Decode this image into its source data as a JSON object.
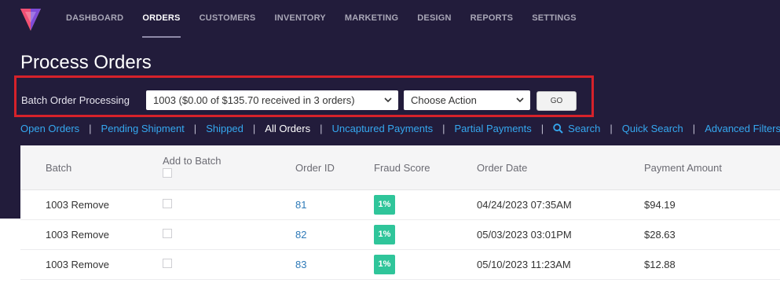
{
  "nav": {
    "items": [
      {
        "label": "DASHBOARD",
        "active": false
      },
      {
        "label": "ORDERS",
        "active": true
      },
      {
        "label": "CUSTOMERS",
        "active": false
      },
      {
        "label": "INVENTORY",
        "active": false
      },
      {
        "label": "MARKETING",
        "active": false
      },
      {
        "label": "DESIGN",
        "active": false
      },
      {
        "label": "REPORTS",
        "active": false
      },
      {
        "label": "SETTINGS",
        "active": false
      }
    ]
  },
  "page": {
    "title": "Process Orders"
  },
  "batch": {
    "label": "Batch Order Processing",
    "selected_batch": "1003 ($0.00 of $135.70 received in 3 orders)",
    "action_selected": "Choose Action",
    "go_label": "GO"
  },
  "filters": [
    {
      "label": "Open Orders",
      "active": false
    },
    {
      "label": "Pending Shipment",
      "active": false
    },
    {
      "label": "Shipped",
      "active": false
    },
    {
      "label": "All Orders",
      "active": true
    },
    {
      "label": "Uncaptured Payments",
      "active": false
    },
    {
      "label": "Partial Payments",
      "active": false
    },
    {
      "label": "Search",
      "active": false,
      "icon": "search-icon"
    },
    {
      "label": "Quick Search",
      "active": false
    },
    {
      "label": "Advanced Filters",
      "active": false
    }
  ],
  "table": {
    "headers": {
      "batch": "Batch",
      "add_to_batch": "Add to Batch",
      "order_id": "Order ID",
      "fraud_score": "Fraud Score",
      "order_date": "Order Date",
      "payment_amount": "Payment Amount"
    },
    "rows": [
      {
        "batch": "1003 Remove",
        "order_id": "81",
        "fraud": "1%",
        "date": "04/24/2023 07:35AM",
        "amount": "$94.19"
      },
      {
        "batch": "1003 Remove",
        "order_id": "82",
        "fraud": "1%",
        "date": "05/03/2023 03:01PM",
        "amount": "$28.63"
      },
      {
        "batch": "1003 Remove",
        "order_id": "83",
        "fraud": "1%",
        "date": "05/10/2023 11:23AM",
        "amount": "$12.88"
      }
    ]
  },
  "colors": {
    "header_bg": "#221c3b",
    "highlight_border": "#d6222a",
    "link": "#35a8f0",
    "fraud_badge": "#2fc59a",
    "order_id_link": "#2e7ab8"
  }
}
